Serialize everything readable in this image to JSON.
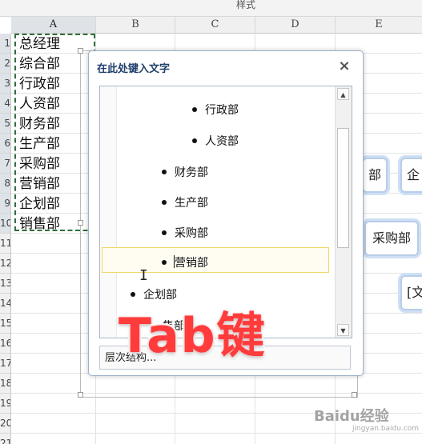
{
  "ribbon": {
    "group_label": "样式"
  },
  "columns": [
    "A",
    "B",
    "C",
    "D",
    "E"
  ],
  "rows": [
    "1",
    "2",
    "3",
    "4",
    "5",
    "6",
    "7",
    "8",
    "9",
    "10",
    "11",
    "12",
    "13",
    "14",
    "15",
    "16",
    "17",
    "18",
    "19",
    "20",
    "21"
  ],
  "cells": [
    "总经理",
    "综合部",
    "行政部",
    "人资部",
    "财务部",
    "生产部",
    "采购部",
    "营销部",
    "企划部",
    "销售部"
  ],
  "smartart_nodes": [
    "部",
    "企",
    "采购部",
    "[文"
  ],
  "text_pane": {
    "title": "在此处键入文字",
    "close": "×",
    "items": [
      "行政部",
      "人资部",
      "财务部",
      "生产部",
      "采购部",
      "营销部",
      "企划部",
      "售部"
    ],
    "footer": "层次结构..."
  },
  "overlay_caption": "Tab键",
  "watermark": {
    "brand": "Baidu经验",
    "sub": "jingyan.baidu.com"
  }
}
